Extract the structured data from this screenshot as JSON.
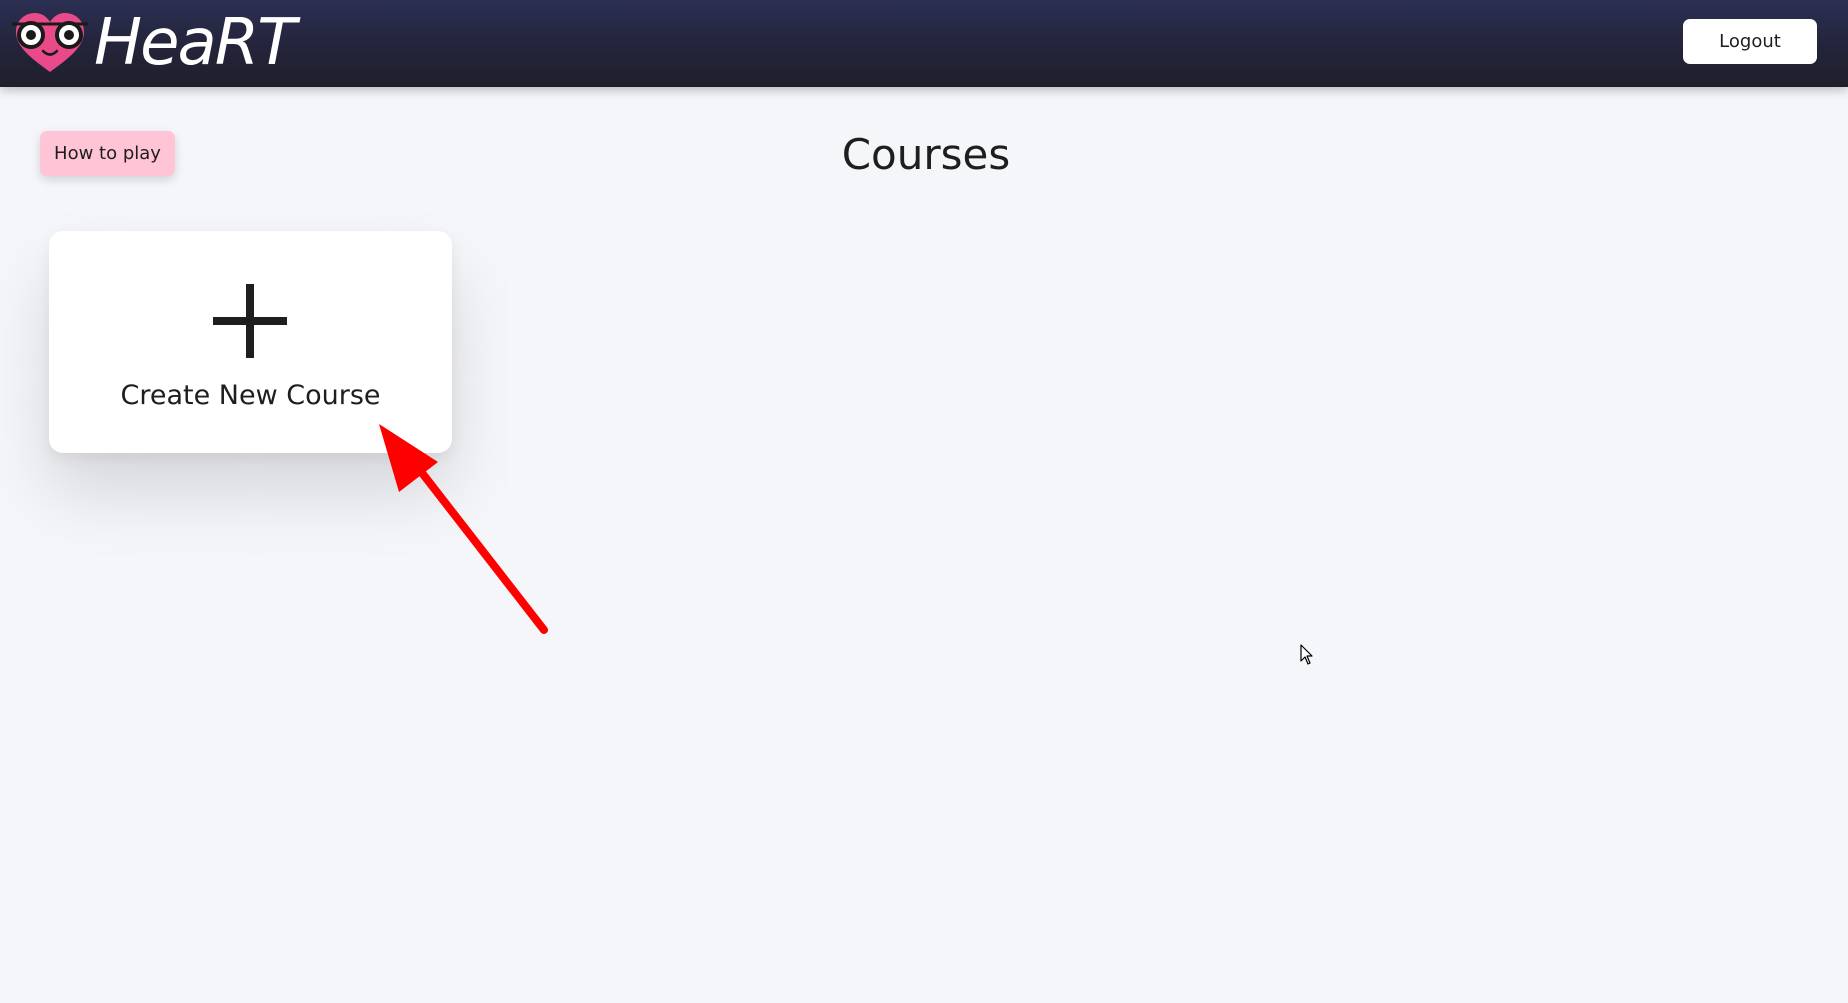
{
  "header": {
    "app_name": "HeaRT",
    "logo_icon": "heart-with-glasses-icon",
    "logout_label": "Logout"
  },
  "main": {
    "how_to_play_label": "How to play",
    "title": "Courses",
    "create_card": {
      "icon": "plus-icon",
      "label": "Create New Course"
    }
  },
  "colors": {
    "header_bg": "#23243a",
    "page_bg": "#f5f6fa",
    "how_to_play_bg": "#ffc4d6",
    "heart_pink": "#e84a8a",
    "annotation_arrow": "#ff0000"
  }
}
